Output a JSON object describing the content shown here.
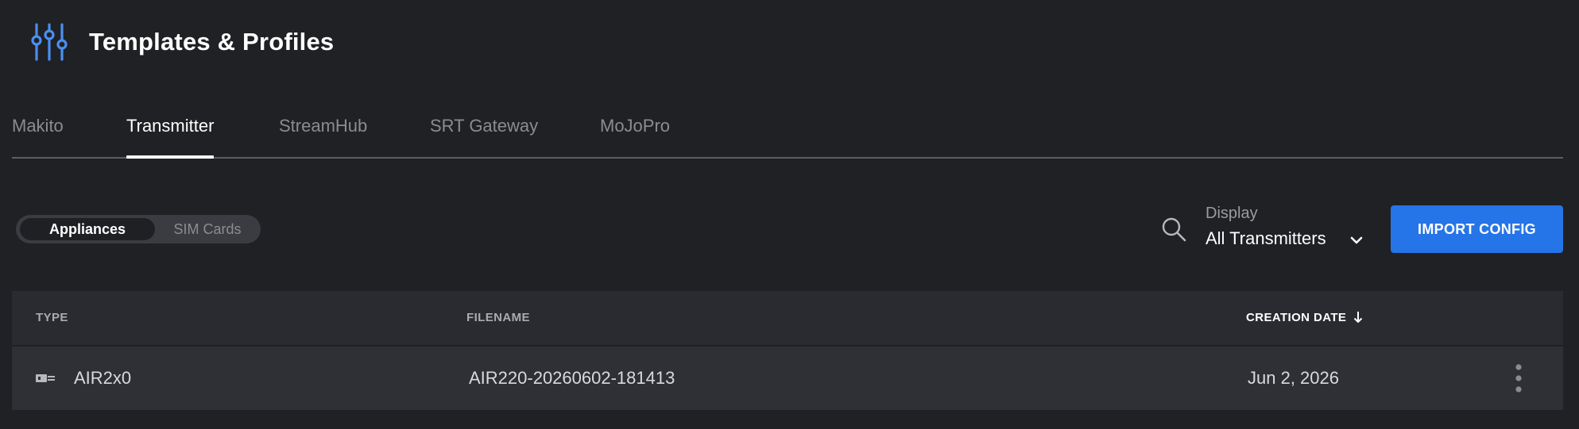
{
  "header": {
    "icon": "sliders-icon",
    "title": "Templates & Profiles"
  },
  "tabs": [
    {
      "label": "Makito",
      "active": false
    },
    {
      "label": "Transmitter",
      "active": true
    },
    {
      "label": "StreamHub",
      "active": false
    },
    {
      "label": "SRT Gateway",
      "active": false
    },
    {
      "label": "MoJoPro",
      "active": false
    }
  ],
  "segmented": {
    "options": [
      {
        "label": "Appliances",
        "active": true
      },
      {
        "label": "SIM Cards",
        "active": false
      }
    ]
  },
  "toolbar": {
    "search_icon": "search-icon",
    "display_label": "Display",
    "display_value": "All Transmitters",
    "display_icon": "chevron-down-icon",
    "import_label": "IMPORT CONFIG"
  },
  "table": {
    "columns": [
      {
        "label": "TYPE",
        "sorted": false
      },
      {
        "label": "FILENAME",
        "sorted": false
      },
      {
        "label": "CREATION DATE",
        "sorted": true,
        "sort_direction": "descending",
        "sort_icon": "arrow-down-icon"
      }
    ],
    "rows": [
      {
        "type_icon": "transmitter-device-icon",
        "type": "AIR2x0",
        "filename": "AIR220-20260602-181413",
        "creation_date": "Jun 2, 2026",
        "menu_icon": "more-vertical-icon"
      }
    ]
  },
  "colors": {
    "background": "#202124",
    "accent_blue": "#2574e8",
    "icon_blue": "#4a8ff0",
    "table_header_bg": "#2a2b30",
    "table_row_bg": "#2f3036"
  }
}
